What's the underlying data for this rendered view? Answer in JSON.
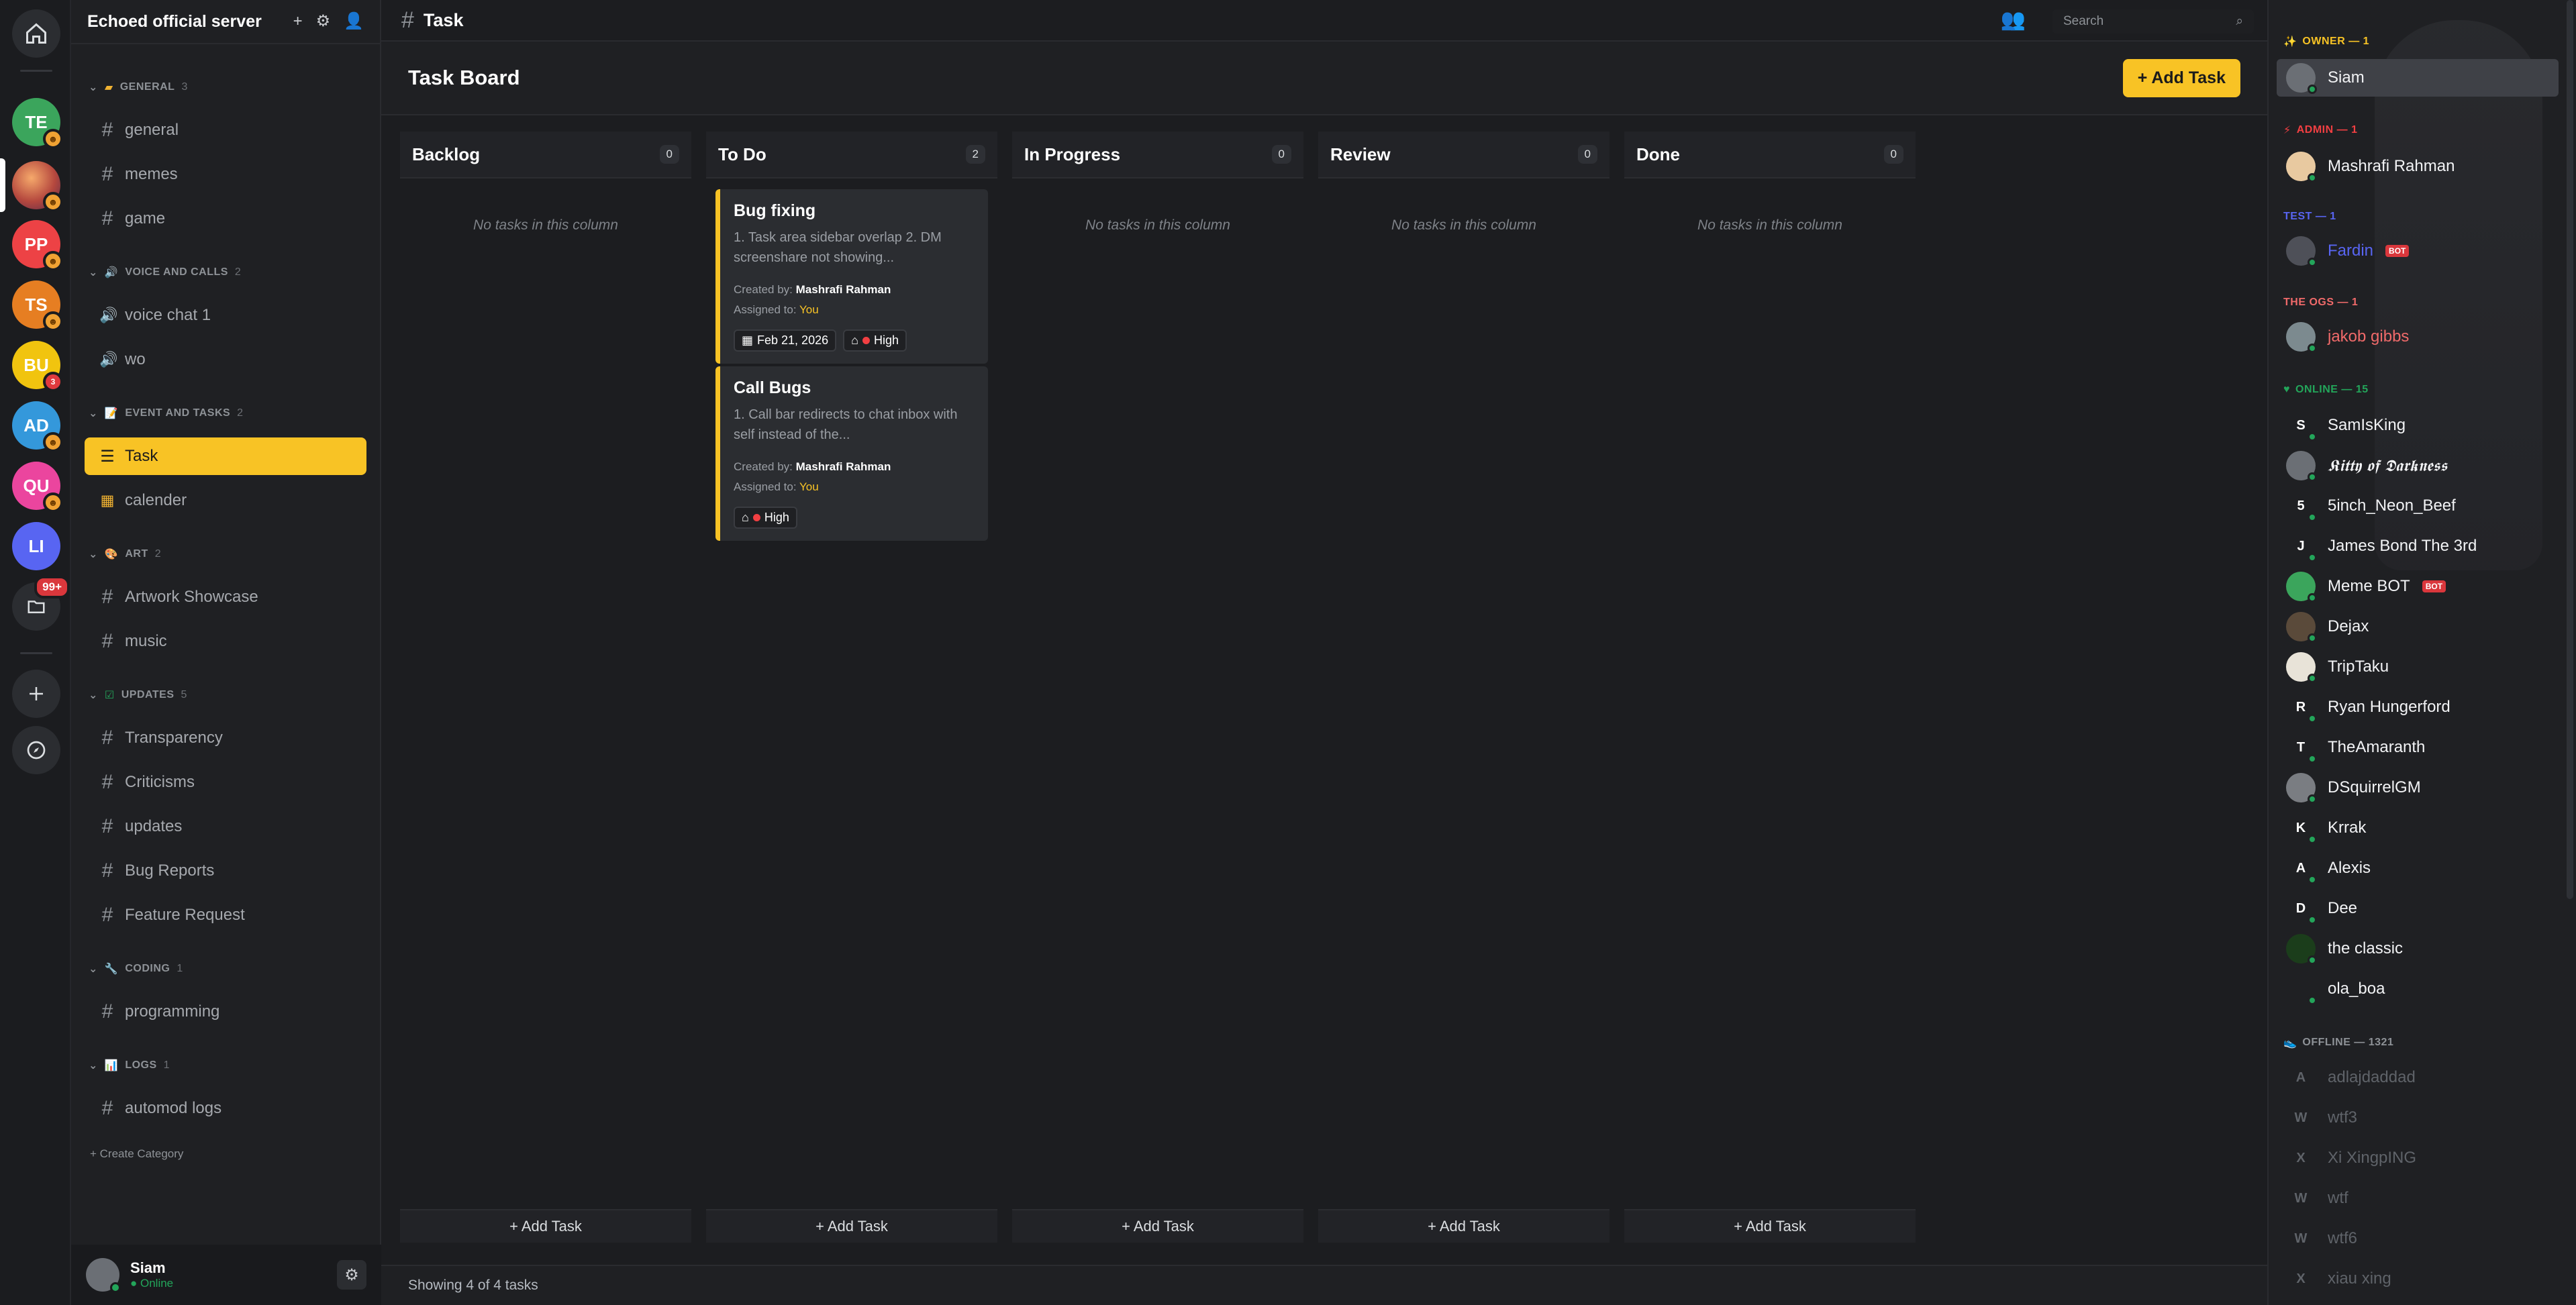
{
  "rail": {
    "servers": [
      {
        "label": "TE",
        "color": "#3ba55c",
        "badge": "☻"
      },
      {
        "label": "",
        "color": "#b5483e",
        "badge": "☻",
        "image": true
      },
      {
        "label": "PP",
        "color": "#ed4245",
        "badge": "☻"
      },
      {
        "label": "TS",
        "color": "#e67e22",
        "badge": "☻"
      },
      {
        "label": "BU",
        "color": "#f1c40f",
        "badge": "3"
      },
      {
        "label": "AD",
        "color": "#3498db",
        "badge": "☻"
      },
      {
        "label": "QU",
        "color": "#eb459e",
        "badge": "☻"
      },
      {
        "label": "LI",
        "color": "#5865f2",
        "badge": ""
      }
    ],
    "folder_count": "99+"
  },
  "server": {
    "name": "Echoed official server"
  },
  "categories": {
    "general": {
      "label": "GENERAL",
      "count": "3"
    },
    "voice": {
      "label": "VOICE AND CALLS",
      "count": "2"
    },
    "events": {
      "label": "EVENT AND TASKS",
      "count": "2"
    },
    "art": {
      "label": "ART",
      "count": "2"
    },
    "updates": {
      "label": "UPDATES",
      "count": "5"
    },
    "coding": {
      "label": "CODING",
      "count": "1"
    },
    "logs": {
      "label": "LOGS",
      "count": "1"
    }
  },
  "channels": {
    "general": "general",
    "memes": "memes",
    "game": "game",
    "voice1": "voice chat 1",
    "wo": "wo",
    "task": "Task",
    "calender": "calender",
    "artwork": "Artwork Showcase",
    "music": "music",
    "transparency": "Transparency",
    "criticisms": "Criticisms",
    "updates": "updates",
    "bugs": "Bug Reports",
    "feature": "Feature Request",
    "programming": "programming",
    "automod": "automod logs"
  },
  "create_category": "Create Category",
  "user": {
    "name": "Siam",
    "status": "Online"
  },
  "topbar": {
    "title": "Task",
    "search_placeholder": "Search"
  },
  "board": {
    "title": "Task Board",
    "add_label": "+ Add Task"
  },
  "columns": [
    {
      "name": "Backlog",
      "count": "0",
      "empty": "No tasks in this column",
      "add": "+ Add Task"
    },
    {
      "name": "To Do",
      "count": "2",
      "empty": "",
      "add": "+ Add Task"
    },
    {
      "name": "In Progress",
      "count": "0",
      "empty": "No tasks in this column",
      "add": "+ Add Task"
    },
    {
      "name": "Review",
      "count": "0",
      "empty": "No tasks in this column",
      "add": "+ Add Task"
    },
    {
      "name": "Done",
      "count": "0",
      "empty": "No tasks in this column",
      "add": "+ Add Task"
    }
  ],
  "cards": [
    {
      "title": "Bug fixing",
      "desc": "1. Task area sidebar overlap 2. DM screenshare not showing...",
      "created_label": "Created by:",
      "created_by": "Mashrafi Rahman",
      "assigned_label": "Assigned to:",
      "assigned": "You",
      "date": "Feb 21, 2026",
      "priority": "High"
    },
    {
      "title": "Call Bugs",
      "desc": "1. Call bar redirects to chat inbox with self instead of the...",
      "created_label": "Created by:",
      "created_by": "Mashrafi Rahman",
      "assigned_label": "Assigned to:",
      "assigned": "You",
      "priority": "High"
    }
  ],
  "footer": "Showing 4 of 4 tasks",
  "members": {
    "owner_label": "OWNER — 1",
    "admin_label": "ADMIN — 1",
    "test_label": "TEST — 1",
    "ogs_label": "THE OGS — 1",
    "online_label": "ONLINE — 15",
    "offline_label": "OFFLINE — 1321",
    "owner": "Siam",
    "admin": "Mashrafi Rahman",
    "test": "Fardin",
    "ogs": "jakob gibbs",
    "bot_tag": "BOT",
    "online": [
      "SamIsKing",
      "𝕶𝖎𝖙𝖙𝖞 𝖔𝖋 𝕯𝖆𝖗𝖐𝖓𝖊𝖘𝖘",
      "5inch_Neon_Beef",
      "James Bond The 3rd",
      "Meme BOT",
      "Dejax",
      "TripTaku",
      "Ryan Hungerford",
      "TheAmaranth",
      "DSquirrelGM",
      "Krrak",
      "Alexis",
      "Dee",
      "the classic",
      "ola_boa"
    ],
    "online_initials": [
      "S",
      "",
      "5",
      "J",
      "",
      "",
      "",
      "R",
      "T",
      "",
      "K",
      "A",
      "D",
      "",
      ""
    ],
    "offline": [
      "adlajdaddad",
      "wtf3",
      "Xi XingpING",
      "wtf",
      "wtf6",
      "xiau xing"
    ],
    "offline_initials": [
      "A",
      "W",
      "X",
      "W",
      "W",
      "X"
    ]
  },
  "colors": {
    "accent": "#f8c325",
    "owner": "#f8c325",
    "admin": "#f23f42",
    "test": "#5865f2",
    "ogs": "#f06a6a",
    "online": "#23a55a",
    "offline": "#5865f2"
  }
}
